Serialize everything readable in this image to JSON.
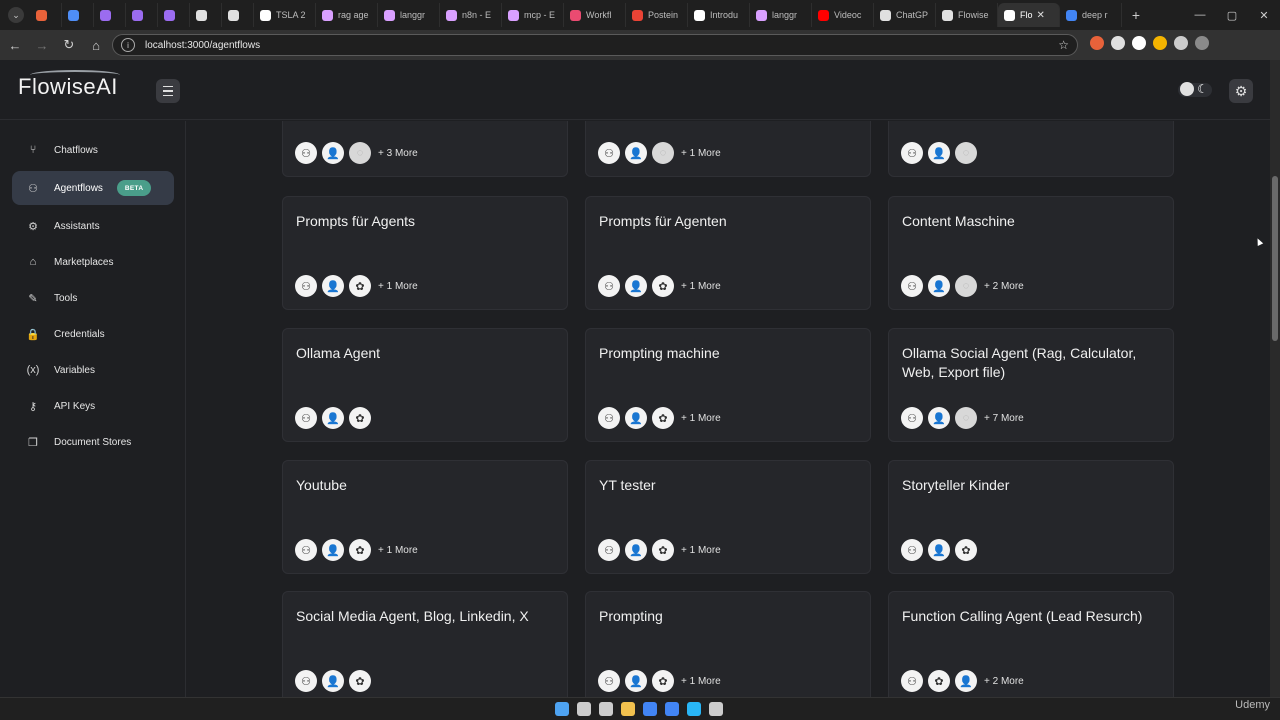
{
  "browser": {
    "tabs": [
      {
        "label": "",
        "color": "#e8623a"
      },
      {
        "label": "",
        "color": "#4f8ef7"
      },
      {
        "label": "",
        "color": "#9b6cf0"
      },
      {
        "label": "",
        "color": "#9b6cf0"
      },
      {
        "label": "",
        "color": "#9b6cf0"
      },
      {
        "label": "",
        "color": "#e0e0e0"
      },
      {
        "label": "",
        "color": "#e0e0e0"
      },
      {
        "label": "TSLA 2",
        "color": "#ffffff"
      },
      {
        "label": "rag age",
        "color": "#d9a0ff"
      },
      {
        "label": "langgr",
        "color": "#d9a0ff"
      },
      {
        "label": "n8n - E",
        "color": "#d9a0ff"
      },
      {
        "label": "mcp - E",
        "color": "#d9a0ff"
      },
      {
        "label": "Workfl",
        "color": "#ea4b71"
      },
      {
        "label": "Postein",
        "color": "#ea4335"
      },
      {
        "label": "Introdu",
        "color": "#ffffff"
      },
      {
        "label": "langgr",
        "color": "#d9a0ff"
      },
      {
        "label": "Videoc",
        "color": "#ff0000"
      },
      {
        "label": "ChatGP",
        "color": "#e0e0e0"
      },
      {
        "label": "Flowise",
        "color": "#e0e0e0"
      },
      {
        "label": "Flo",
        "color": "#ffffff",
        "active": true
      },
      {
        "label": "deep r",
        "color": "#4285f4"
      }
    ],
    "new_tab": "+",
    "url": "localhost:3000/agentflows",
    "nav": {
      "back": "←",
      "forward": "→",
      "reload": "↻",
      "home": "⌂"
    },
    "window_controls": {
      "minimize": "—",
      "maximize": "▢",
      "close": "✕"
    },
    "extensions": [
      "#e8623a",
      "#e0e0e0",
      "#ffffff",
      "#f4b400",
      "#cccccc",
      "#8a8a8a"
    ]
  },
  "app": {
    "logo_text": "FlowiseAI",
    "sidebar": [
      {
        "label": "Chatflows",
        "icon": "chatflow-icon",
        "glyph": "⑂"
      },
      {
        "label": "Agentflows",
        "icon": "agents-icon",
        "glyph": "⚇",
        "active": true,
        "badge": "BETA"
      },
      {
        "label": "Assistants",
        "icon": "robot-icon",
        "glyph": "⚙"
      },
      {
        "label": "Marketplaces",
        "icon": "store-icon",
        "glyph": "⌂"
      },
      {
        "label": "Tools",
        "icon": "wrench-icon",
        "glyph": "✎"
      },
      {
        "label": "Credentials",
        "icon": "lock-icon",
        "glyph": "🔒"
      },
      {
        "label": "Variables",
        "icon": "variable-icon",
        "glyph": "(x)"
      },
      {
        "label": "API Keys",
        "icon": "key-icon",
        "glyph": "⚷"
      },
      {
        "label": "Document Stores",
        "icon": "files-icon",
        "glyph": "❐"
      }
    ],
    "cards": [
      {
        "title": "",
        "icons": [
          "agent",
          "user",
          "faded"
        ],
        "more": "+ 3 More"
      },
      {
        "title": "",
        "icons": [
          "agent",
          "user",
          "faded"
        ],
        "more": "+ 1 More"
      },
      {
        "title": "",
        "icons": [
          "agent",
          "user",
          "faded"
        ],
        "more": ""
      },
      {
        "title": "Prompts für Agents",
        "icons": [
          "agent",
          "user",
          "openai"
        ],
        "more": "+ 1 More"
      },
      {
        "title": "Prompts für Agenten",
        "icons": [
          "agent",
          "user",
          "openai"
        ],
        "more": "+ 1 More"
      },
      {
        "title": "Content Maschine",
        "icons": [
          "agent",
          "user",
          "faded"
        ],
        "more": "+ 2 More"
      },
      {
        "title": "Ollama Agent",
        "icons": [
          "agent",
          "user",
          "openai"
        ],
        "more": ""
      },
      {
        "title": "Prompting machine",
        "icons": [
          "agent",
          "user",
          "openai"
        ],
        "more": "+ 1 More"
      },
      {
        "title": "Ollama Social Agent (Rag, Calculator, Web, Export file)",
        "icons": [
          "agent",
          "user",
          "faded"
        ],
        "more": "+ 7 More"
      },
      {
        "title": "Youtube",
        "icons": [
          "agent",
          "user",
          "openai"
        ],
        "more": "+ 1 More"
      },
      {
        "title": "YT tester",
        "icons": [
          "agent",
          "user",
          "openai"
        ],
        "more": "+ 1 More"
      },
      {
        "title": "Storyteller Kinder",
        "icons": [
          "agent",
          "user",
          "openai"
        ],
        "more": ""
      },
      {
        "title": "Social Media Agent, Blog, Linkedin, X",
        "icons": [
          "agent",
          "user",
          "openai"
        ],
        "more": ""
      },
      {
        "title": "Prompting",
        "icons": [
          "agent",
          "user",
          "openai"
        ],
        "more": "+ 1 More"
      },
      {
        "title": "Function Calling Agent (Lead Resurch)",
        "icons": [
          "agent",
          "openai",
          "user"
        ],
        "more": "+ 2 More"
      }
    ]
  },
  "taskbar": {
    "icons": [
      "#4ea3f1",
      "#cccccc",
      "#cccccc",
      "#f2c14e",
      "#4285f4",
      "#4285f4",
      "#29b6f6",
      "#cccccc"
    ],
    "watermark": "Udemy"
  }
}
